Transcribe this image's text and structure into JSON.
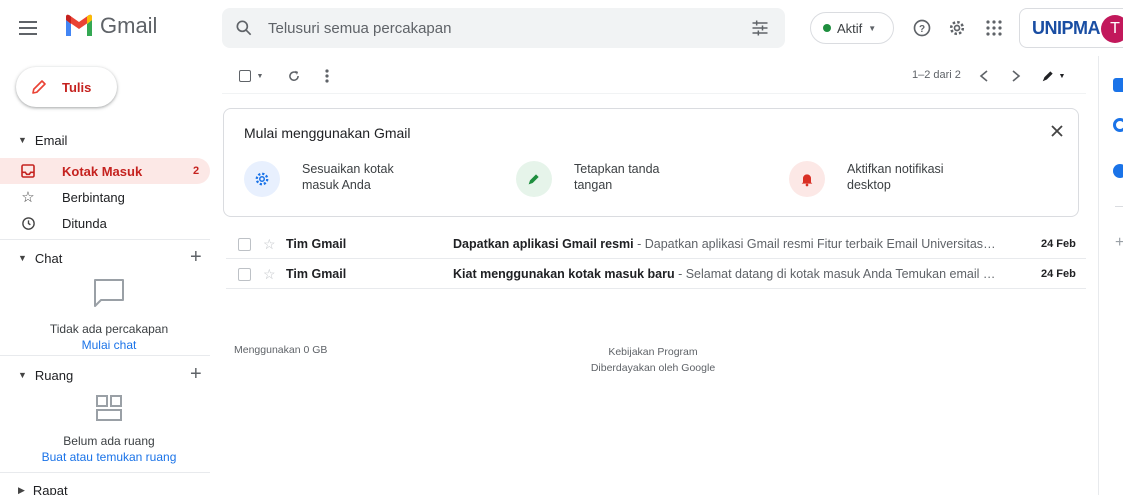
{
  "header": {
    "app_name": "Gmail",
    "search_placeholder": "Telusuri semua percakapan",
    "status_label": "Aktif",
    "brand_text": "UNIPMA",
    "avatar_initial": "T",
    "colors": {
      "status_green": "#1e8e3e",
      "avatar_bg": "#c2185b",
      "brand_blue": "#1a4ea3"
    }
  },
  "sidebar": {
    "compose_label": "Tulis",
    "email_section": "Email",
    "items": [
      {
        "label": "Kotak Masuk",
        "count": "2",
        "icon": "inbox-icon",
        "active": true
      },
      {
        "label": "Berbintang",
        "icon": "star-icon",
        "active": false
      },
      {
        "label": "Ditunda",
        "icon": "clock-icon",
        "active": false
      }
    ],
    "chat": {
      "title": "Chat",
      "empty_text": "Tidak ada percakapan",
      "link": "Mulai chat"
    },
    "rooms": {
      "title": "Ruang",
      "empty_text": "Belum ada ruang",
      "link": "Buat atau temukan ruang"
    },
    "meet": {
      "title": "Rapat"
    }
  },
  "toolbar": {
    "pagination": "1–2 dari 2"
  },
  "getting_started": {
    "title": "Mulai menggunakan Gmail",
    "tips": [
      {
        "text": "Sesuaikan kotak masuk Anda",
        "icon": "gear-icon",
        "color": "#1a73e8",
        "bg": "#e8f0fe"
      },
      {
        "text": "Tetapkan tanda tangan",
        "icon": "pen-icon",
        "color": "#1e8e3e",
        "bg": "#e6f4ea"
      },
      {
        "text": "Aktifkan notifikasi desktop",
        "icon": "bell-icon",
        "color": "#d93025",
        "bg": "#fce8e6"
      }
    ]
  },
  "emails": [
    {
      "sender": "Tim Gmail",
      "subject": "Dapatkan aplikasi Gmail resmi",
      "snippet": " - Dapatkan aplikasi Gmail resmi Fitur terbaik Email Universitas PGRI ...",
      "date": "24 Feb"
    },
    {
      "sender": "Tim Gmail",
      "subject": "Kiat menggunakan kotak masuk baru",
      "snippet": " - Selamat datang di kotak masuk Anda Temukan email dengan...",
      "date": "24 Feb"
    }
  ],
  "footer": {
    "storage": "Menggunakan 0 GB",
    "policy": "Kebijakan Program",
    "powered": "Diberdayakan oleh Google"
  }
}
